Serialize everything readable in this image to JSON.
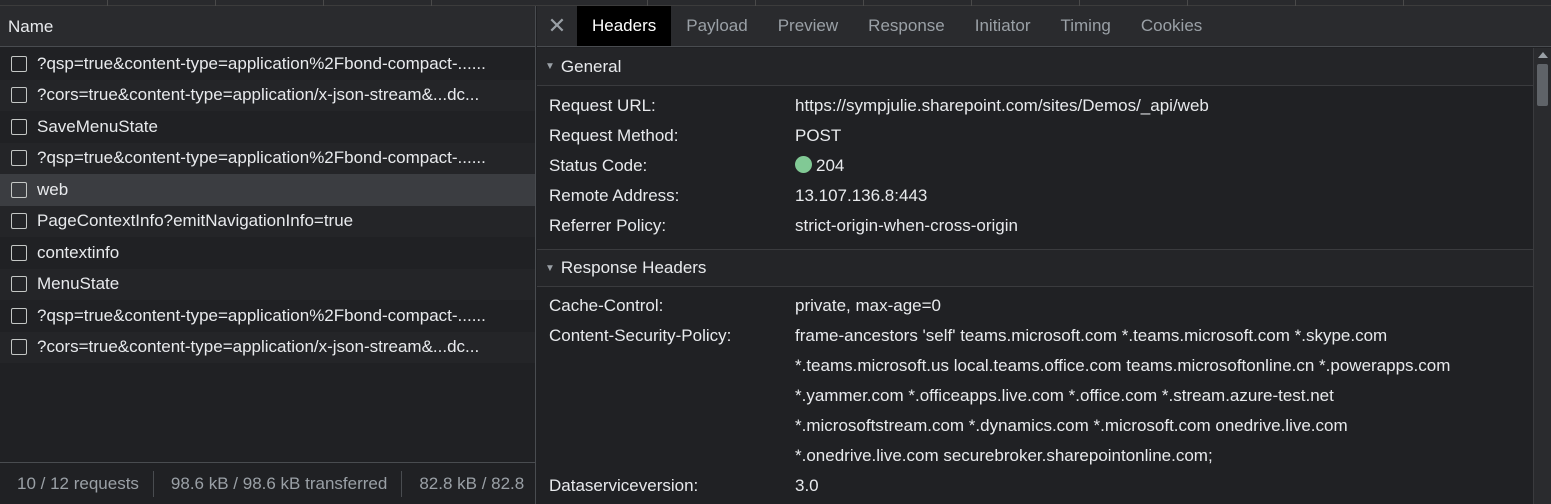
{
  "network_list": {
    "column_header": "Name",
    "requests": [
      {
        "name": "?qsp=true&content-type=application%2Fbond-compact-......"
      },
      {
        "name": "?cors=true&content-type=application/x-json-stream&...dc..."
      },
      {
        "name": "SaveMenuState"
      },
      {
        "name": "?qsp=true&content-type=application%2Fbond-compact-......"
      },
      {
        "name": "web"
      },
      {
        "name": "PageContextInfo?emitNavigationInfo=true"
      },
      {
        "name": "contextinfo"
      },
      {
        "name": "MenuState"
      },
      {
        "name": "?qsp=true&content-type=application%2Fbond-compact-......"
      },
      {
        "name": "?cors=true&content-type=application/x-json-stream&...dc..."
      }
    ],
    "selected_request": "web"
  },
  "status_bar": {
    "requests": "10 / 12 requests",
    "transferred": "98.6 kB / 98.6 kB transferred",
    "resources": "82.8 kB / 82.8"
  },
  "details": {
    "close_icon": "close-icon",
    "tabs": [
      {
        "label": "Headers"
      },
      {
        "label": "Payload"
      },
      {
        "label": "Preview"
      },
      {
        "label": "Response"
      },
      {
        "label": "Initiator"
      },
      {
        "label": "Timing"
      },
      {
        "label": "Cookies"
      }
    ],
    "active_tab": "Headers",
    "general": {
      "title": "General",
      "request_url_label": "Request URL:",
      "request_url": "https://sympjulie.sharepoint.com/sites/Demos/_api/web",
      "request_method_label": "Request Method:",
      "request_method": "POST",
      "status_code_label": "Status Code:",
      "status_code": "204",
      "status_color": "#81c995",
      "remote_address_label": "Remote Address:",
      "remote_address": "13.107.136.8:443",
      "referrer_policy_label": "Referrer Policy:",
      "referrer_policy": "strict-origin-when-cross-origin"
    },
    "response_headers": {
      "title": "Response Headers",
      "cache_control_label": "Cache-Control:",
      "cache_control": "private, max-age=0",
      "csp_label": "Content-Security-Policy:",
      "csp_lines": [
        "frame-ancestors 'self' teams.microsoft.com *.teams.microsoft.com *.skype.com",
        "*.teams.microsoft.us local.teams.office.com teams.microsoftonline.cn *.powerapps.com",
        "*.yammer.com *.officeapps.live.com *.office.com *.stream.azure-test.net",
        "*.microsoftstream.com *.dynamics.com *.microsoft.com onedrive.live.com",
        "*.onedrive.live.com securebroker.sharepointonline.com;"
      ],
      "dataservice_label": "Dataserviceversion:",
      "dataservice": "3.0"
    }
  },
  "colors": {
    "background": "#202124",
    "active_tab_bg": "#000000",
    "selected_row_bg": "#3b3d41",
    "status_ok": "#81c995"
  }
}
